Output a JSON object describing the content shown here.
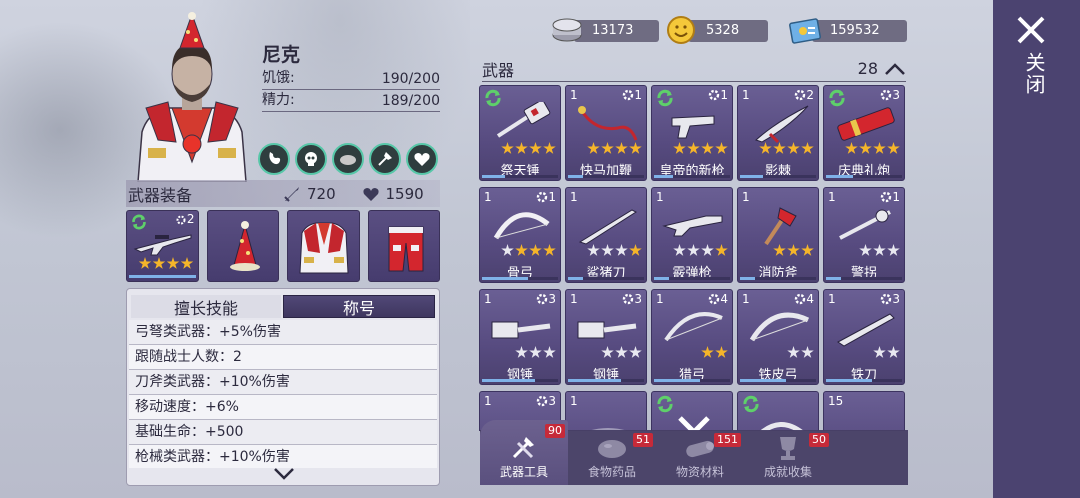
{
  "character": {
    "name": "尼克",
    "hunger_label": "饥饿:",
    "hunger_value": "190/200",
    "energy_label": "精力:",
    "energy_value": "189/200"
  },
  "equipment": {
    "title": "武器装备",
    "attack": "720",
    "health": "1590",
    "slots": [
      {
        "type": "rifle",
        "level": "2",
        "stars": 4
      },
      {
        "type": "party-hat"
      },
      {
        "type": "jacket"
      },
      {
        "type": "pants"
      }
    ]
  },
  "skills": {
    "tab_skills": "擅长技能",
    "tab_title": "称号",
    "rows": [
      "弓弩类武器：+5%伤害",
      "跟随战士人数：2",
      "刀斧类武器：+10%伤害",
      "移动速度：+6%",
      "基础生命：+500",
      "枪械类武器：+10%伤害"
    ]
  },
  "currencies": {
    "silver": "13173",
    "gold": "5328",
    "tickets": "159532"
  },
  "weapons": {
    "title": "武器",
    "count": "28",
    "cards": [
      {
        "count": "",
        "level": "",
        "refresh": true,
        "stars": 4,
        "name": "祭天锤",
        "progress": 0.3
      },
      {
        "count": "1",
        "level": "1",
        "refresh": false,
        "stars": 4,
        "name": "快马加鞭",
        "progress": 0.2
      },
      {
        "count": "",
        "level": "1",
        "refresh": true,
        "stars": 4,
        "name": "皇帝的新枪",
        "progress": 0.25
      },
      {
        "count": "1",
        "level": "2",
        "refresh": false,
        "stars": 4,
        "name": "影棘",
        "progress": 0.3
      },
      {
        "count": "",
        "level": "3",
        "refresh": true,
        "stars": 4,
        "name": "庆典礼炮",
        "progress": 0.35
      },
      {
        "count": "1",
        "level": "1",
        "refresh": false,
        "stars": 4,
        "name": "骨弓",
        "progress": 0.6
      },
      {
        "count": "1",
        "level": "",
        "refresh": false,
        "stars": 4,
        "name": "鲨猪刀",
        "progress": 0.2
      },
      {
        "count": "1",
        "level": "",
        "refresh": false,
        "stars": 4,
        "name": "霰弹枪",
        "progress": 0.2
      },
      {
        "count": "1",
        "level": "",
        "refresh": false,
        "stars": 3,
        "name": "消防斧",
        "progress": 0.2
      },
      {
        "count": "1",
        "level": "1",
        "refresh": false,
        "stars": 3,
        "name": "警拐",
        "progress": 0.2
      },
      {
        "count": "1",
        "level": "3",
        "refresh": false,
        "stars": 3,
        "name": "钢锤",
        "progress": 0.7
      },
      {
        "count": "1",
        "level": "3",
        "refresh": false,
        "stars": 3,
        "name": "钢锤",
        "progress": 0.7
      },
      {
        "count": "1",
        "level": "4",
        "refresh": false,
        "stars": 2,
        "name": "猎弓",
        "progress": 0.6
      },
      {
        "count": "1",
        "level": "4",
        "refresh": false,
        "stars": 2,
        "name": "铁皮弓",
        "progress": 0.6
      },
      {
        "count": "1",
        "level": "3",
        "refresh": false,
        "stars": 2,
        "name": "铁刀",
        "progress": 0.6
      },
      {
        "count": "1",
        "level": "3",
        "refresh": false,
        "stars": 0,
        "name": "",
        "progress": 0
      },
      {
        "count": "1",
        "level": "",
        "refresh": false,
        "stars": 0,
        "name": "",
        "progress": 0
      },
      {
        "count": "",
        "level": "",
        "refresh": true,
        "stars": 0,
        "name": "",
        "progress": 0
      },
      {
        "count": "",
        "level": "",
        "refresh": true,
        "stars": 0,
        "name": "",
        "progress": 0
      },
      {
        "count": "15",
        "level": "",
        "refresh": false,
        "stars": 0,
        "name": "",
        "progress": 0
      }
    ]
  },
  "bottom_tabs": [
    {
      "label": "武器工具",
      "badge": "90",
      "icon": "tools-icon",
      "active": true
    },
    {
      "label": "食物药品",
      "badge": "51",
      "icon": "food-icon",
      "active": false
    },
    {
      "label": "物资材料",
      "badge": "151",
      "icon": "material-icon",
      "active": false
    },
    {
      "label": "成就收集",
      "badge": "50",
      "icon": "trophy-icon",
      "active": false
    }
  ],
  "close": {
    "label": "关闭"
  }
}
